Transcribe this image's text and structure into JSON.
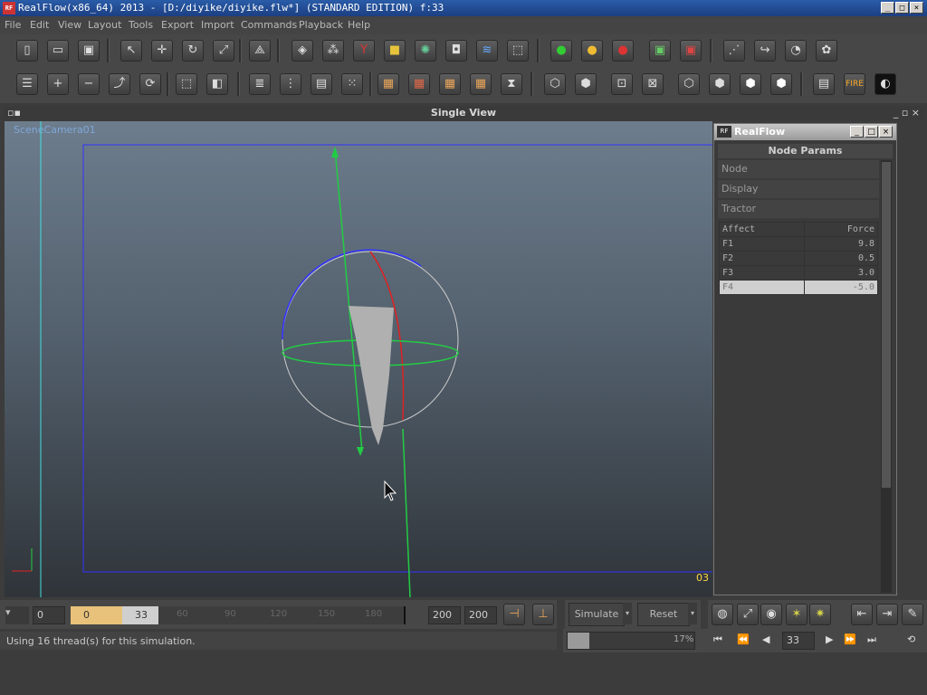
{
  "window": {
    "title": "RealFlow(x86_64) 2013 - [D:/diyike/diyike.flw*] (STANDARD EDITION) f:33",
    "app_icon": "RF",
    "minimize": "_",
    "maximize": "□",
    "close": "×"
  },
  "menu": [
    "File",
    "Edit",
    "View",
    "Layout",
    "Tools",
    "Export",
    "Import",
    "Commands",
    "Playback",
    "Help"
  ],
  "viewport": {
    "title": "Single View",
    "camera_label": "SceneCamera01",
    "edge_label": "03"
  },
  "realflow_panel": {
    "title": "RealFlow",
    "node_params_title": "Node Params",
    "sections": [
      "Node",
      "Display",
      "Tractor"
    ],
    "table_headers": [
      "Affect",
      "Force"
    ],
    "rows": [
      {
        "affect": "F1",
        "force": "9.8"
      },
      {
        "affect": "F2",
        "force": "0.5"
      },
      {
        "affect": "F3",
        "force": "3.0"
      },
      {
        "affect": "F4",
        "force": "-5.0"
      }
    ],
    "selected_row": "F4"
  },
  "timeline": {
    "start": "0",
    "current_start": "0",
    "current_frame": "33",
    "ticks": [
      "60",
      "90",
      "120",
      "150",
      "180"
    ],
    "end1": "200",
    "end2": "200"
  },
  "simulation": {
    "simulate_label": "Simulate",
    "reset_label": "Reset",
    "progress_percent": "17%",
    "progress_value": 17
  },
  "status": {
    "message": "Using 16 thread(s) for this simulation."
  },
  "transport": {
    "frame": "33"
  },
  "colors": {
    "title_bar": "#1c3f82",
    "sphere_ring": "#3333ff",
    "axis_green": "#22cc44",
    "axis_red": "#dd2222",
    "camera_cyan": "#44dddd"
  }
}
